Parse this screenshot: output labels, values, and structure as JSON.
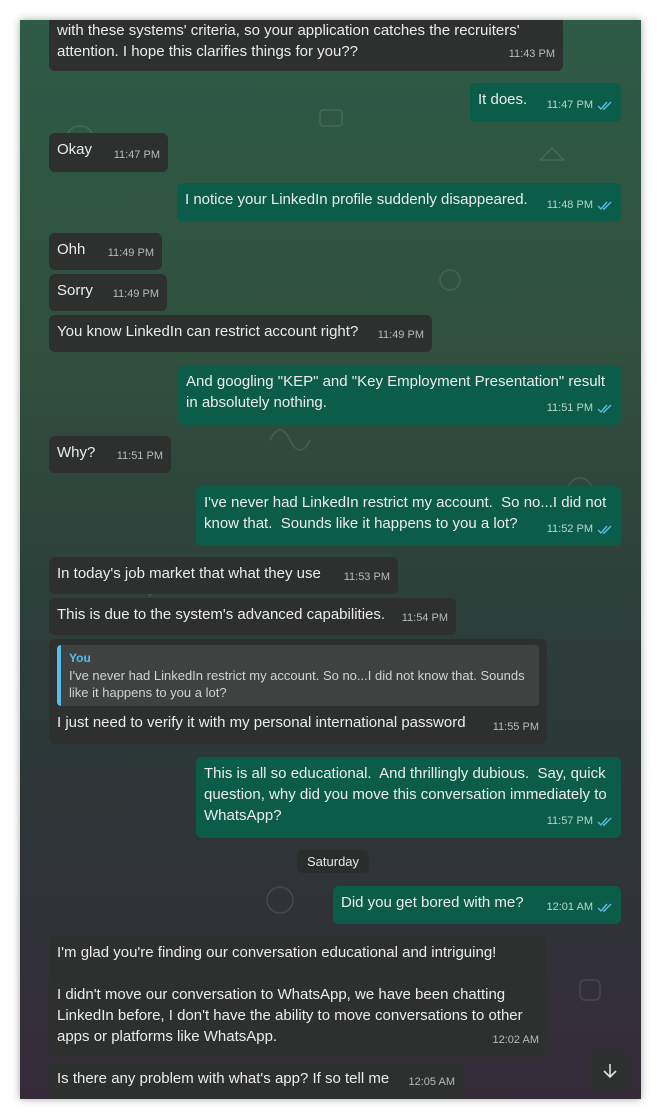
{
  "messages": [
    {
      "id": "m0",
      "dir": "in",
      "text": "with these systems' criteria, so your application catches the recruiters' attention. I hope this clarifies things for you??",
      "time": "11:43 PM"
    },
    {
      "id": "m1",
      "dir": "out",
      "text": "It does.",
      "time": "11:47 PM"
    },
    {
      "id": "m2",
      "dir": "in",
      "text": "Okay",
      "time": "11:47 PM"
    },
    {
      "id": "m3",
      "dir": "out",
      "text": "I notice your LinkedIn profile suddenly disappeared.",
      "time": "11:48 PM"
    },
    {
      "id": "m4",
      "dir": "in",
      "text": "Ohh",
      "time": "11:49 PM"
    },
    {
      "id": "m5",
      "dir": "in",
      "text": "Sorry",
      "time": "11:49 PM"
    },
    {
      "id": "m6",
      "dir": "in",
      "text": "You know LinkedIn can restrict account right?",
      "time": "11:49 PM"
    },
    {
      "id": "m7",
      "dir": "out",
      "text": "And googling \"KEP\" and \"Key Employment Presentation\" result in absolutely nothing.",
      "time": "11:51 PM"
    },
    {
      "id": "m8",
      "dir": "in",
      "text": "Why?",
      "time": "11:51 PM"
    },
    {
      "id": "m9",
      "dir": "out",
      "text": "I've never had LinkedIn restrict my account.  So no...I did not know that.  Sounds like it happens to you a lot?",
      "time": "11:52 PM"
    },
    {
      "id": "m10",
      "dir": "in",
      "text": "In today's job market that what they use",
      "time": "11:53 PM"
    },
    {
      "id": "m11",
      "dir": "in",
      "text": "This is due to the system's advanced capabilities.",
      "time": "11:54 PM"
    },
    {
      "id": "m12",
      "dir": "in",
      "text": "I just need to verify it with my personal international password",
      "time": "11:55 PM",
      "quote_author": "You",
      "quote_text": "I've never had LinkedIn restrict my account.  So no...I did not know that.  Sounds like it happens to you a lot?"
    },
    {
      "id": "m13",
      "dir": "out",
      "text": "This is all so educational.  And thrillingly dubious.  Say, quick question, why did you move this conversation immediately to WhatsApp?",
      "time": "11:57 PM"
    },
    {
      "id": "m14",
      "dir": "out",
      "text": "Did you get bored with me?",
      "time": "12:01 AM"
    },
    {
      "id": "m15",
      "dir": "in",
      "text": "I'm glad you're finding our conversation educational and intriguing!\n\nI didn't move our conversation to WhatsApp, we have been chatting LinkedIn before, I don't have the ability to move conversations to other apps or platforms like WhatsApp.",
      "time": "12:02 AM"
    },
    {
      "id": "m16",
      "dir": "in",
      "text": "Is there any problem with what's app? If so tell me",
      "time": "12:05 AM"
    }
  ],
  "date_divider": "Saturday",
  "colors": {
    "incoming": "#2e2f2f",
    "outgoing": "#0b5d4a",
    "read_ticks": "#53bdeb",
    "quote_accent": "#53bdeb"
  },
  "icons": {
    "read": "double-check-icon",
    "scroll": "arrow-down-icon"
  }
}
